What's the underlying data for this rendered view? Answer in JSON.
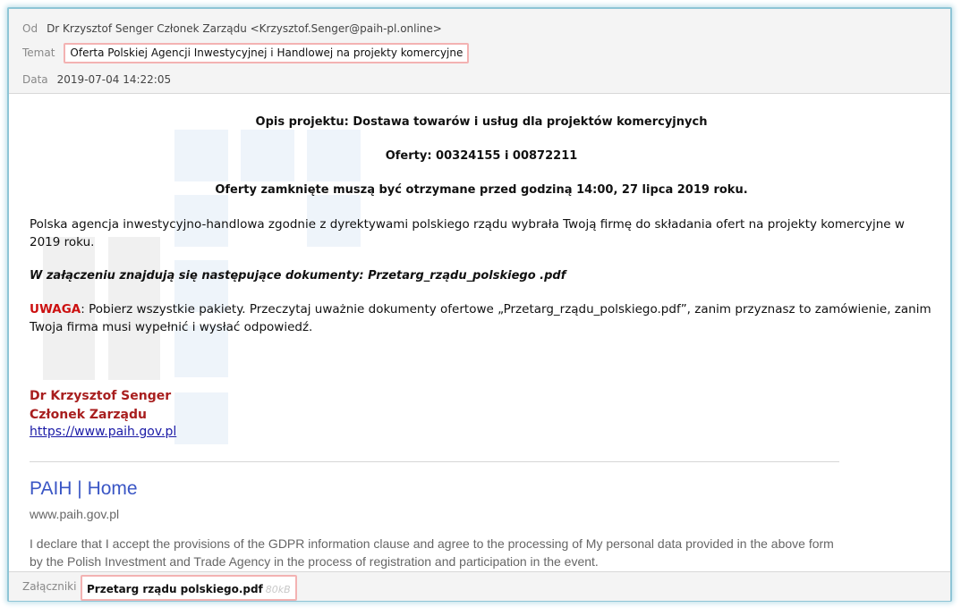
{
  "header": {
    "from_label": "Od",
    "from_value": "Dr Krzysztof Senger Członek Zarządu <Krzysztof.Senger@paih-pl.online>",
    "subject_label": "Temat",
    "subject_value": "Oferta Polskiej Agencji Inwestycyjnej i Handlowej na projekty komercyjne",
    "date_label": "Data",
    "date_value": "2019-07-04 14:22:05"
  },
  "body": {
    "heading1": "Opis projektu: Dostawa towarów i usług dla projektów komercyjnych",
    "heading2": "Oferty: 00324155 i 00872211",
    "heading3": "Oferty zamknięte muszą być otrzymane przed godziną 14:00, 27 lipca 2019 roku.",
    "paragraph1": "Polska agencja inwestycyjno-handlowa zgodnie z dyrektywami polskiego rządu wybrała Twoją firmę do składania ofert na projekty komercyjne w 2019 roku.",
    "attachments_note": "W załączeniu znajdują się następujące dokumenty: Przetarg_rządu_polskiego .pdf",
    "warning_label": "UWAGA",
    "warning_text": ": Pobierz wszystkie pakiety. Przeczytaj uważnie dokumenty ofertowe „Przetarg_rządu_polskiego.pdf”, zanim przyznasz to zamówienie, zanim Twoja firma musi wypełnić i wysłać odpowiedź.",
    "signature_name": "Dr Krzysztof Senger",
    "signature_title": "Członek Zarządu",
    "signature_link": "https://www.paih.gov.pl",
    "preview_title": "PAIH | Home",
    "preview_url": "www.paih.gov.pl",
    "preview_text": "I declare that I accept the provisions of the GDPR information clause and agree to the processing of My personal data provided in the above form by the Polish Investment and Trade Agency in the process of registration and participation in the event."
  },
  "footer": {
    "attachments_label": "Załączniki",
    "attachment_name": "Przetarg rządu polskiego.pdf",
    "attachment_size": "80kB"
  },
  "colors": {
    "frame_border": "#8ec5d6",
    "highlight_border": "#f3b2b2",
    "warning": "#cc1111",
    "signature": "#a81e1e",
    "link": "#1a1aa6",
    "preview_title": "#3a56c5"
  }
}
